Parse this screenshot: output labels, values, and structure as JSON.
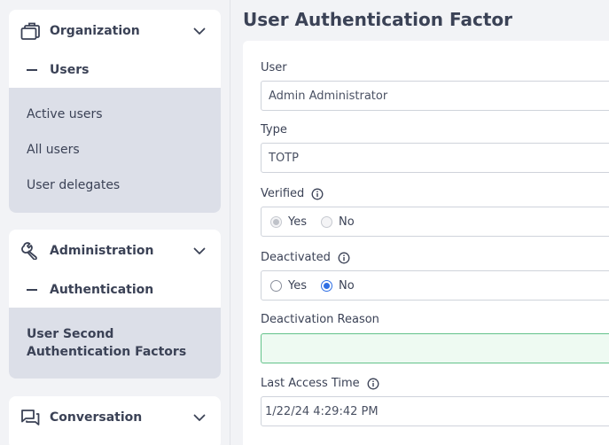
{
  "sidebar": {
    "sections": [
      {
        "title": "Organization",
        "icon": "briefcase-icon",
        "subheader": "Users",
        "items": [
          "Active users",
          "All users",
          "User delegates"
        ]
      },
      {
        "title": "Administration",
        "icon": "wrench-icon",
        "subheader": "Authentication",
        "active_item": "User Second Authentication Factors"
      },
      {
        "title": "Conversation",
        "icon": "chat-icon"
      }
    ]
  },
  "main": {
    "title": "User Authentication Factor",
    "fields": {
      "user": {
        "label": "User",
        "value": "Admin Administrator"
      },
      "type": {
        "label": "Type",
        "value": "TOTP"
      },
      "verified": {
        "label": "Verified",
        "yes": "Yes",
        "no": "No",
        "selected": "Yes",
        "disabled": true
      },
      "deactivated": {
        "label": "Deactivated",
        "yes": "Yes",
        "no": "No",
        "selected": "No"
      },
      "deactivation_reason": {
        "label": "Deactivation Reason",
        "value": ""
      },
      "last_access_time": {
        "label": "Last Access Time",
        "value": "1/22/24 4:29:42 PM"
      }
    }
  },
  "colors": {
    "accent": "#2f6fe4",
    "sidebar_selected_bg": "#dcdfe8",
    "text": "#3b4256",
    "valid_field_bg": "#eefaf2",
    "valid_field_border": "#63c28a"
  }
}
